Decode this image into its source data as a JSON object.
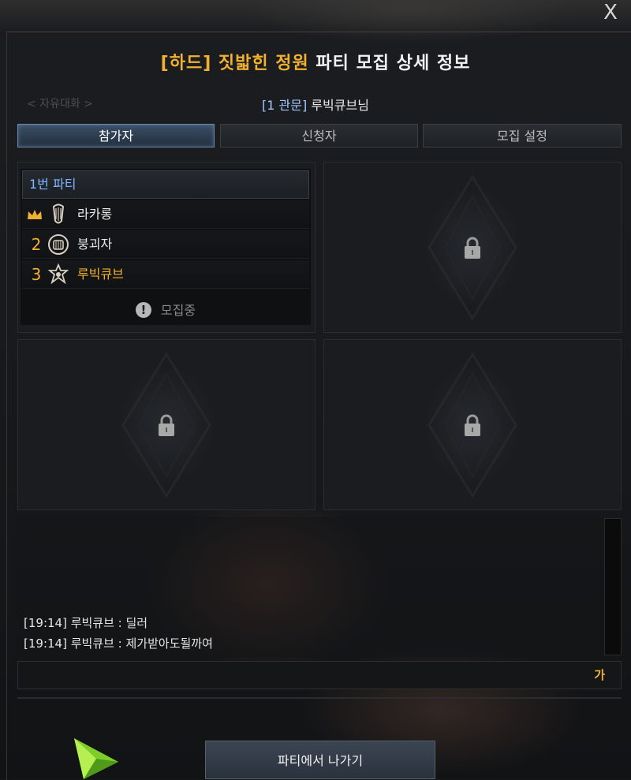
{
  "window": {
    "close_label": "X",
    "title_prefix": "[하드] 짓밟힌 정원",
    "title_suffix": " 파티 모집 상세 정보",
    "ghost_label": "< 자유대화 >"
  },
  "leader": {
    "area_tag": "[1 관문]",
    "name": " 루빅큐브님"
  },
  "tabs": [
    {
      "label": "참가자",
      "active": true
    },
    {
      "label": "신청자",
      "active": false
    },
    {
      "label": "모집 설정",
      "active": false
    }
  ],
  "party": {
    "header": "1번 파티",
    "members": [
      {
        "slot": "leader",
        "icon": "bard-class-icon",
        "name": "라카롱"
      },
      {
        "slot": "2",
        "icon": "destroyer-class-icon",
        "name": "붕괴자"
      },
      {
        "slot": "3",
        "icon": "class-emblem-icon",
        "name": "루빅큐브"
      }
    ],
    "status": "모집중"
  },
  "chat": {
    "lines": [
      "[19:14] 루빅큐브 : 딜러",
      "[19:14] 루빅큐브 : 제가받아도될까여"
    ],
    "input_lang": "가"
  },
  "footer": {
    "leave_label": "파티에서 나가기"
  },
  "colors": {
    "gold": "#f0b030",
    "blue_text": "#7fb6ff",
    "leader_tag": "#9ec8ff"
  }
}
